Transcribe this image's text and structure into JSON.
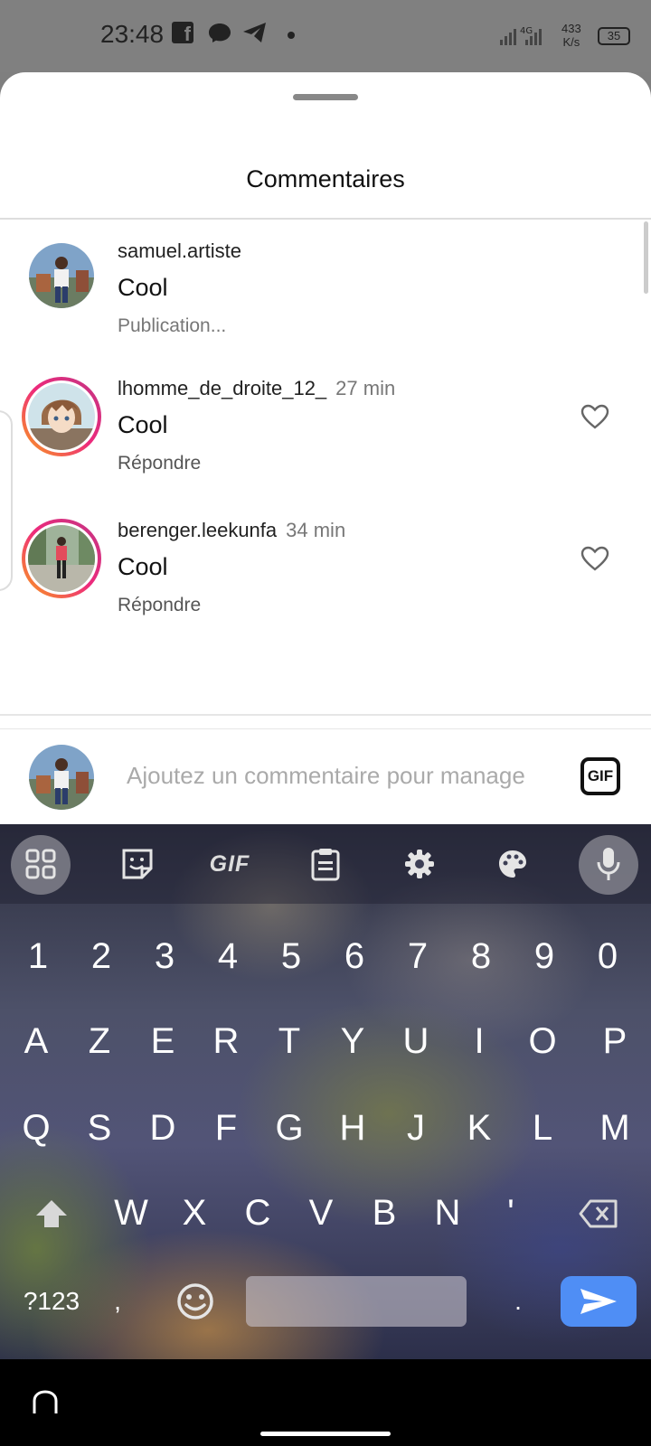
{
  "status_bar": {
    "time": "23:48",
    "network_badge": "4G",
    "speed_value": "433",
    "speed_unit": "K/s",
    "battery": "35"
  },
  "sheet": {
    "title": "Commentaires"
  },
  "comments": [
    {
      "username": "samuel.artiste",
      "time": "",
      "text": "Cool",
      "action": "Publication..."
    },
    {
      "username": "lhomme_de_droite_12_",
      "time": "27 min",
      "text": "Cool",
      "action": "Répondre"
    },
    {
      "username": "berenger.leekunfa",
      "time": "34 min",
      "text": "Cool",
      "action": "Répondre"
    }
  ],
  "emoji_bar": {
    "emojis": [
      "❤️",
      "🙌",
      "🔥",
      "👏",
      "😢",
      "😍",
      "😮",
      "😂"
    ]
  },
  "comment_input": {
    "placeholder": "Ajoutez un commentaire pour manage",
    "gif_label": "GIF"
  },
  "keyboard": {
    "toolbar_gif_label": "GIF",
    "number_row": [
      "1",
      "2",
      "3",
      "4",
      "5",
      "6",
      "7",
      "8",
      "9",
      "0"
    ],
    "row1": [
      "A",
      "Z",
      "E",
      "R",
      "T",
      "Y",
      "U",
      "I",
      "O",
      "P"
    ],
    "row2": [
      "Q",
      "S",
      "D",
      "F",
      "G",
      "H",
      "J",
      "K",
      "L",
      "M"
    ],
    "row3": [
      "W",
      "X",
      "C",
      "V",
      "B",
      "N",
      "'"
    ],
    "symbols_label": "?123",
    "comma_label": ",",
    "period_label": "."
  },
  "colors": {
    "send_button": "#4f8ef5",
    "story_ring_start": "#f9a11b",
    "story_ring_end": "#c13584",
    "like_heart": "#e02424"
  }
}
